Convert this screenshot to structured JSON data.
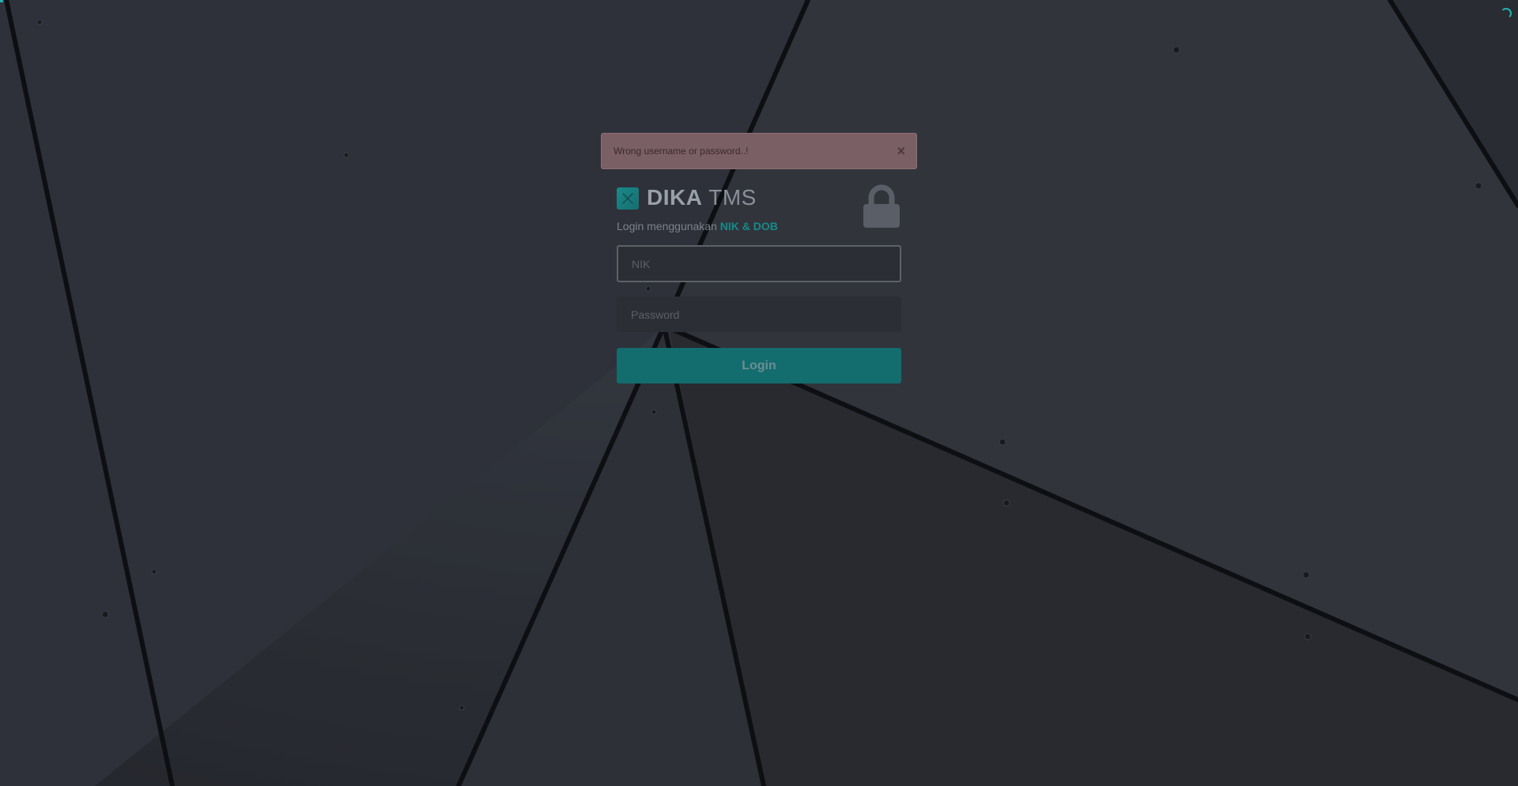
{
  "alert": {
    "message": "Wrong username or password..!",
    "close_label": "×"
  },
  "brand": {
    "name_bold": "DIKA",
    "name_light": " TMS",
    "subtitle_prefix": "Login menggunakan ",
    "subtitle_accent": "NIK & DOB",
    "logo_icon": "logo-icon",
    "lock_icon": "lock-icon"
  },
  "form": {
    "nik_placeholder": "NIK",
    "nik_value": "",
    "password_placeholder": "Password",
    "password_value": "",
    "login_label": "Login"
  },
  "colors": {
    "accent": "#1a8a8a",
    "button": "#136c6e",
    "alert_bg": "#7a5f64",
    "background": "#30343b"
  }
}
